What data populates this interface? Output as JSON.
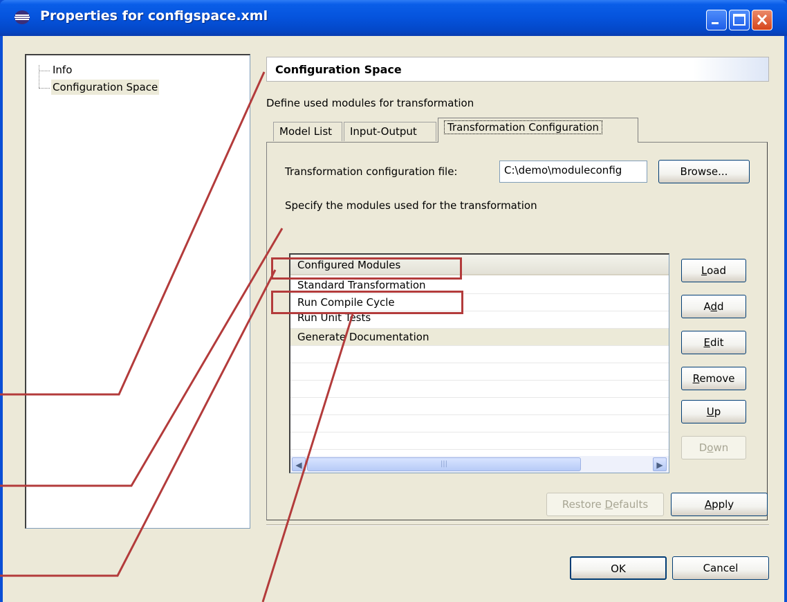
{
  "window": {
    "title": "Properties for configspace.xml"
  },
  "tree": {
    "items": [
      {
        "label": "Info"
      },
      {
        "label": "Configuration Space"
      }
    ]
  },
  "page": {
    "title": "Configuration Space",
    "description": "Define used modules for transformation"
  },
  "tabs": [
    {
      "label": "Model List"
    },
    {
      "label": "Input-Output"
    },
    {
      "label": "Transformation Configuration"
    }
  ],
  "transformation": {
    "file_label": "Transformation configuration file:",
    "file_value": "C:\\demo\\moduleconfig",
    "browse_label": "Browse...",
    "modules_label": "Specify the modules used for the transformation",
    "column_header": "Configured Modules",
    "modules": [
      "Standard Transformation",
      "Run Compile Cycle",
      "Run Unit Tests",
      "Generate Documentation"
    ]
  },
  "side_buttons": {
    "load": {
      "pre": "",
      "key": "L",
      "post": "oad"
    },
    "add": {
      "pre": "A",
      "key": "d",
      "post": "d"
    },
    "edit": {
      "pre": "",
      "key": "E",
      "post": "dit"
    },
    "remove": {
      "pre": "",
      "key": "R",
      "post": "emove"
    },
    "up": {
      "pre": "",
      "key": "U",
      "post": "p"
    },
    "down": {
      "pre": "D",
      "key": "o",
      "post": "wn"
    }
  },
  "footer": {
    "restore_pre": "Restore ",
    "restore_key": "D",
    "restore_post": "efaults",
    "apply_key": "A",
    "apply_post": "pply",
    "ok_label": "OK",
    "cancel_label": "Cancel"
  },
  "colors": {
    "titlebar": "#0553dc",
    "annotation": "#b33b3b",
    "dialog_bg": "#ece9d8"
  }
}
